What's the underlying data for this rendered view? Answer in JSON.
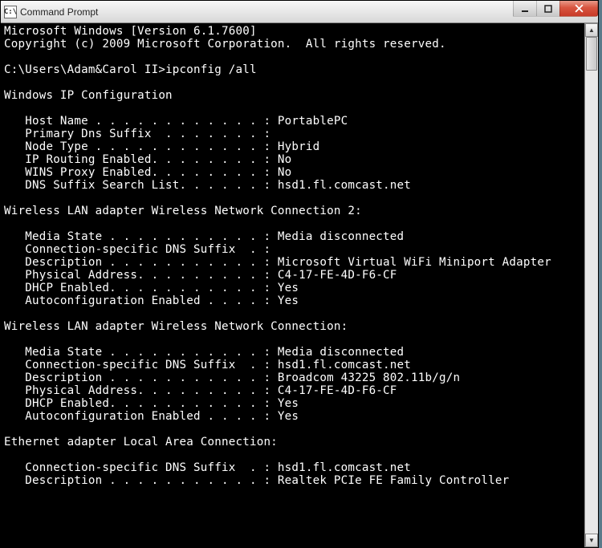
{
  "window": {
    "title": "Command Prompt",
    "icon_text": "C:\\"
  },
  "header": {
    "line1": "Microsoft Windows [Version 6.1.7600]",
    "line2": "Copyright (c) 2009 Microsoft Corporation.  All rights reserved."
  },
  "prompt": {
    "path": "C:\\Users\\Adam&Carol II>",
    "command": "ipconfig /all"
  },
  "sections": {
    "ipconfig_title": "Windows IP Configuration",
    "ipconfig": {
      "host_name": "   Host Name . . . . . . . . . . . . : PortablePC",
      "primary_dns": "   Primary Dns Suffix  . . . . . . . :",
      "node_type": "   Node Type . . . . . . . . . . . . : Hybrid",
      "ip_routing": "   IP Routing Enabled. . . . . . . . : No",
      "wins_proxy": "   WINS Proxy Enabled. . . . . . . . : No",
      "dns_suffix_list": "   DNS Suffix Search List. . . . . . : hsd1.fl.comcast.net"
    },
    "wlan2_title": "Wireless LAN adapter Wireless Network Connection 2:",
    "wlan2": {
      "media_state": "   Media State . . . . . . . . . . . : Media disconnected",
      "conn_suffix": "   Connection-specific DNS Suffix  . :",
      "description": "   Description . . . . . . . . . . . : Microsoft Virtual WiFi Miniport Adapter",
      "physical": "   Physical Address. . . . . . . . . : C4-17-FE-4D-F6-CF",
      "dhcp": "   DHCP Enabled. . . . . . . . . . . : Yes",
      "autoconf": "   Autoconfiguration Enabled . . . . : Yes"
    },
    "wlan_title": "Wireless LAN adapter Wireless Network Connection:",
    "wlan": {
      "media_state": "   Media State . . . . . . . . . . . : Media disconnected",
      "conn_suffix": "   Connection-specific DNS Suffix  . : hsd1.fl.comcast.net",
      "description": "   Description . . . . . . . . . . . : Broadcom 43225 802.11b/g/n",
      "physical": "   Physical Address. . . . . . . . . : C4-17-FE-4D-F6-CF",
      "dhcp": "   DHCP Enabled. . . . . . . . . . . : Yes",
      "autoconf": "   Autoconfiguration Enabled . . . . : Yes"
    },
    "eth_title": "Ethernet adapter Local Area Connection:",
    "eth": {
      "conn_suffix": "   Connection-specific DNS Suffix  . : hsd1.fl.comcast.net",
      "description": "   Description . . . . . . . . . . . : Realtek PCIe FE Family Controller"
    }
  }
}
